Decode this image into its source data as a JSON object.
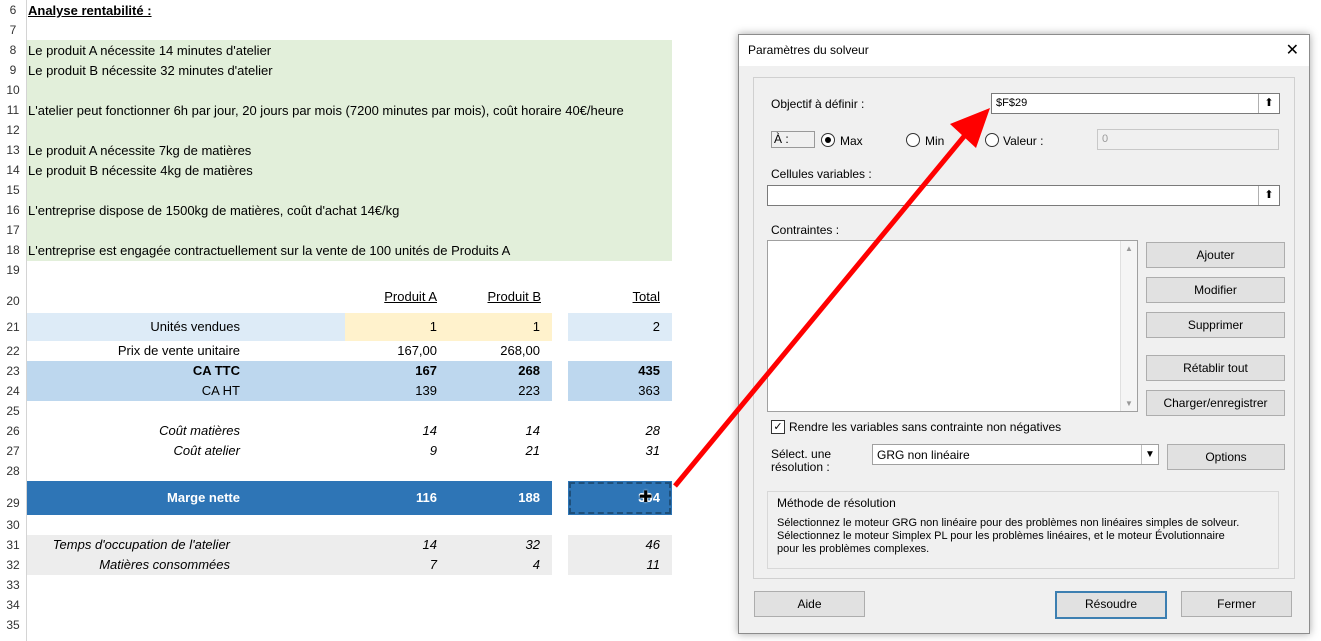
{
  "sheet": {
    "row_numbers": [
      "6",
      "7",
      "8",
      "9",
      "10",
      "11",
      "12",
      "13",
      "14",
      "15",
      "16",
      "17",
      "18",
      "19",
      "20",
      "21",
      "22",
      "23",
      "24",
      "25",
      "26",
      "27",
      "28",
      "29",
      "30",
      "31",
      "32",
      "33",
      "34",
      "35"
    ],
    "title": "Analyse rentabilité :",
    "notes": {
      "r8": "Le produit A nécessite 14 minutes d'atelier",
      "r9": "Le produit B nécessite 32 minutes d'atelier",
      "r11": "L'atelier peut fonctionner 6h par jour, 20 jours par mois (7200 minutes par mois), coût horaire 40€/heure",
      "r13": "Le produit A nécessite 7kg de matières",
      "r14": "Le produit B nécessite 4kg de matières",
      "r16": "L'entreprise dispose de 1500kg de matières, coût d'achat 14€/kg",
      "r18": "L'entreprise est engagée contractuellement sur la vente de 100 unités de Produits A"
    },
    "headers": {
      "a": "Produit A",
      "b": "Produit B",
      "total": "Total"
    },
    "rows": {
      "units": {
        "label": "Unités vendues",
        "a": "1",
        "b": "1",
        "total": "2"
      },
      "price": {
        "label": "Prix de vente unitaire",
        "a": "167,00",
        "b": "268,00"
      },
      "ca_ttc": {
        "label": "CA TTC",
        "a": "167",
        "b": "268",
        "total": "435"
      },
      "ca_ht": {
        "label": "CA HT",
        "a": "139",
        "b": "223",
        "total": "363"
      },
      "cout_mat": {
        "label": "Coût matières",
        "a": "14",
        "b": "14",
        "total": "28"
      },
      "cout_atel": {
        "label": "Coût atelier",
        "a": "9",
        "b": "21",
        "total": "31"
      },
      "marge": {
        "label": "Marge nette",
        "a": "116",
        "b": "188",
        "total": "304"
      },
      "temps": {
        "label": "Temps d'occupation de l'atelier",
        "a": "14",
        "b": "32",
        "total": "46"
      },
      "matieres": {
        "label": "Matières consommées",
        "a": "7",
        "b": "4",
        "total": "11"
      }
    },
    "colors": {
      "note_bg": "#e2efda",
      "input_bg": "#fff2cc",
      "light_blue": "#ddebf7",
      "mid_blue": "#bdd7ee",
      "dark_blue": "#2e75b6",
      "grey": "#ededed",
      "arrow": "#ff0000"
    }
  },
  "dialog": {
    "title": "Paramètres du solveur",
    "objective_label": "Objectif à définir :",
    "objective_value": "$F$29",
    "to_label": "À :",
    "max_label": "Max",
    "min_label": "Min",
    "value_label": "Valeur :",
    "value_field": "0",
    "variables_label": "Cellules variables :",
    "variables_value": "",
    "constraints_label": "Contraintes :",
    "buttons": {
      "add": "Ajouter",
      "modify": "Modifier",
      "delete": "Supprimer",
      "reset": "Rétablir tout",
      "load": "Charger/enregistrer",
      "options": "Options",
      "help": "Aide",
      "solve": "Résoudre",
      "close": "Fermer"
    },
    "nonneg_label": "Rendre les variables sans contrainte non négatives",
    "method_label_1": "Sélect. une",
    "method_label_2": "résolution :",
    "method_value": "GRG non linéaire",
    "group_title": "Méthode de résolution",
    "group_text_1": "Sélectionnez le moteur GRG non linéaire pour des problèmes non linéaires simples de solveur.",
    "group_text_2": "Sélectionnez le moteur Simplex PL pour les problèmes linéaires, et le moteur Évolutionnaire",
    "group_text_3": "pour les problèmes complexes."
  }
}
